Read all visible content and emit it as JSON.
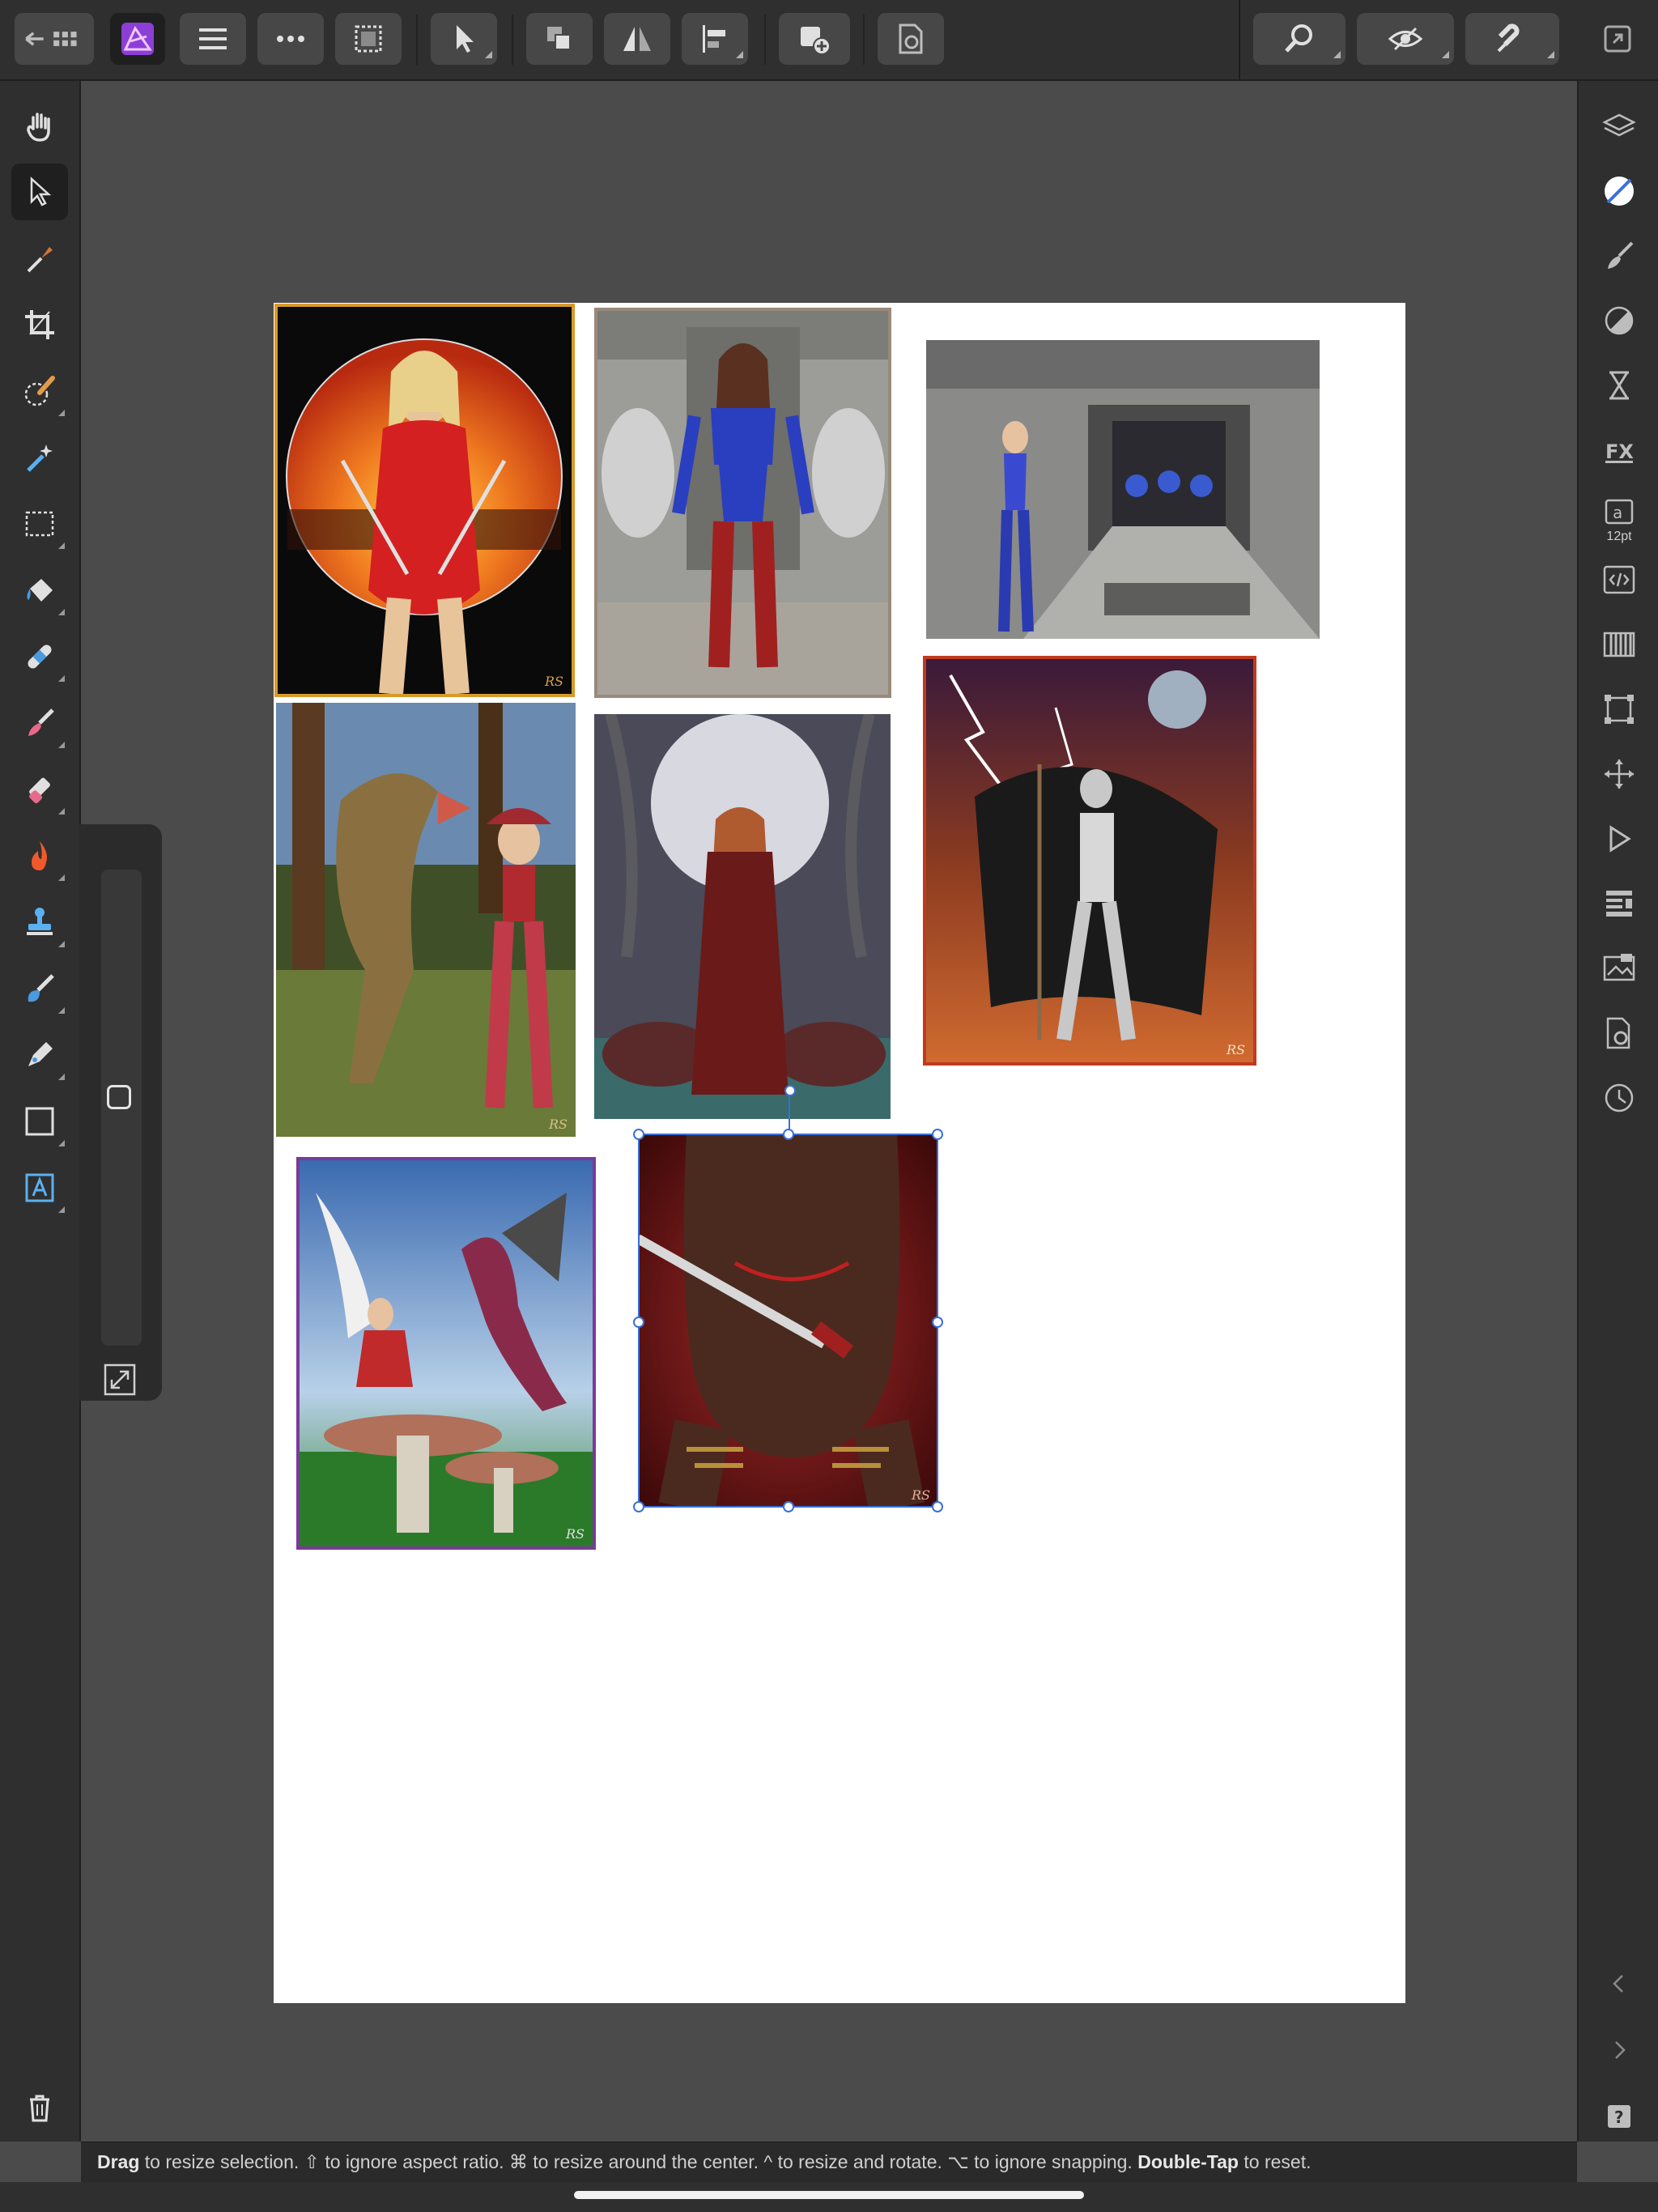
{
  "toolbar": {
    "left_buttons": [
      {
        "name": "back-to-gallery-button",
        "icon": "back-grid-icon"
      },
      {
        "name": "persona-button",
        "icon": "affinity-photo-icon"
      },
      {
        "name": "document-menu-button",
        "icon": "hamburger-icon"
      },
      {
        "name": "more-menu-button",
        "icon": "ellipsis-icon"
      },
      {
        "name": "selection-button",
        "icon": "marquee-icon"
      },
      {
        "name": "move-tool-button",
        "icon": "arrow-cursor-icon"
      },
      {
        "name": "arrange-button",
        "icon": "arrange-icon"
      },
      {
        "name": "flip-button",
        "icon": "flip-icon"
      },
      {
        "name": "align-button",
        "icon": "align-left-icon"
      },
      {
        "name": "add-layer-button",
        "icon": "add-layer-icon"
      },
      {
        "name": "document-settings-button",
        "icon": "document-gear-icon"
      }
    ],
    "right_buttons": [
      {
        "name": "zoom-button",
        "icon": "magnifier-icon"
      },
      {
        "name": "view-mode-button",
        "icon": "eye-icon"
      },
      {
        "name": "snapping-button",
        "icon": "magnet-icon"
      },
      {
        "name": "fullscreen-button",
        "icon": "expand-window-icon"
      }
    ]
  },
  "left_tools": [
    {
      "name": "view-tool",
      "icon": "hand-icon"
    },
    {
      "name": "move-tool",
      "icon": "pointer-icon",
      "active": true
    },
    {
      "name": "color-picker-tool",
      "icon": "eyedropper-icon"
    },
    {
      "name": "crop-tool",
      "icon": "crop-icon"
    },
    {
      "name": "selection-brush-tool",
      "icon": "selection-brush-icon"
    },
    {
      "name": "flood-select-tool",
      "icon": "magic-wand-icon"
    },
    {
      "name": "marquee-tool",
      "icon": "rect-marquee-icon"
    },
    {
      "name": "flood-fill-tool",
      "icon": "paint-bucket-icon"
    },
    {
      "name": "healing-tool",
      "icon": "bandage-icon"
    },
    {
      "name": "paint-brush-tool",
      "icon": "brush-icon"
    },
    {
      "name": "erase-tool",
      "icon": "eraser-icon"
    },
    {
      "name": "burn-tool",
      "icon": "flame-icon"
    },
    {
      "name": "clone-tool",
      "icon": "stamp-icon"
    },
    {
      "name": "smudge-tool",
      "icon": "smudge-icon"
    },
    {
      "name": "pen-tool",
      "icon": "pen-icon"
    },
    {
      "name": "shape-tool",
      "icon": "rectangle-icon"
    },
    {
      "name": "text-tool",
      "icon": "text-frame-icon"
    }
  ],
  "right_studios": [
    {
      "name": "layers-studio",
      "icon": "layers-icon"
    },
    {
      "name": "color-studio",
      "icon": "color-wheel-icon"
    },
    {
      "name": "brushes-studio",
      "icon": "brush-icon"
    },
    {
      "name": "adjustments-studio",
      "icon": "adjustment-icon"
    },
    {
      "name": "history-studio",
      "icon": "hourglass-icon"
    },
    {
      "name": "effects-studio",
      "icon": "fx-icon"
    },
    {
      "name": "character-studio",
      "icon": "character-icon",
      "label": "12pt"
    },
    {
      "name": "macro-studio",
      "icon": "code-icon"
    },
    {
      "name": "channels-studio",
      "icon": "channels-icon"
    },
    {
      "name": "transform-studio",
      "icon": "transform-icon"
    },
    {
      "name": "navigator-studio",
      "icon": "move-cross-icon"
    },
    {
      "name": "play-studio",
      "icon": "play-icon"
    },
    {
      "name": "stock-studio",
      "icon": "list-icon"
    },
    {
      "name": "snapshots-studio",
      "icon": "snapshot-icon"
    },
    {
      "name": "settings-studio",
      "icon": "doc-settings-icon"
    },
    {
      "name": "time-studio",
      "icon": "clock-icon"
    }
  ],
  "right_bottom": [
    {
      "name": "collapse-left-button",
      "icon": "chevron-left-icon"
    },
    {
      "name": "collapse-right-button",
      "icon": "chevron-right-icon"
    },
    {
      "name": "help-button",
      "icon": "help-icon"
    }
  ],
  "context_panel": {
    "brush_size_icon": "rounded-square-icon",
    "resize_icon": "resize-icon"
  },
  "canvas": {
    "photos": [
      {
        "name": "photo-red-warrior",
        "watermark": "RS"
      },
      {
        "name": "photo-sci-fi-heroine",
        "watermark": ""
      },
      {
        "name": "photo-corridor-heroine",
        "watermark": ""
      },
      {
        "name": "photo-dino-cowgirl",
        "watermark": "RS"
      },
      {
        "name": "photo-moon-witch",
        "watermark": ""
      },
      {
        "name": "photo-lightning-queen",
        "watermark": "RS"
      },
      {
        "name": "photo-fairy-dragon",
        "watermark": "RS"
      },
      {
        "name": "photo-sword-warrior",
        "watermark": "RS",
        "selected": true
      }
    ]
  },
  "statusbar": {
    "drag_key": "Drag",
    "drag_text": " to resize selection. ⇧ to ignore aspect ratio. ⌘ to resize around the center. ^ to resize and rotate. ⌥ to ignore snapping. ",
    "double_tap_key": "Double-Tap",
    "reset_text": " to reset."
  },
  "colors": {
    "accent": "#3a6fd8",
    "panel": "#2f2f2f",
    "canvas_bg": "#4b4b4b"
  }
}
